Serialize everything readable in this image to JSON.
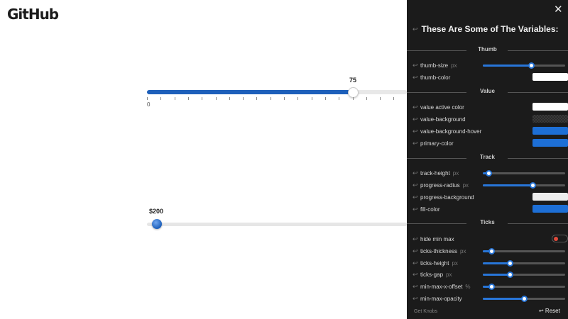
{
  "logo": "GitHub",
  "slider1": {
    "value": 75,
    "min_label": "0",
    "fill_fraction": 0.793,
    "tick_count": 20
  },
  "slider2": {
    "value_label": "$200",
    "fill_fraction": 0.02
  },
  "panel": {
    "close": "✕",
    "return_glyph": "↩",
    "title": "These Are Some of The Variables:",
    "sections": {
      "thumb": "Thumb",
      "value": "Value",
      "track": "Track",
      "ticks": "Ticks"
    },
    "rows": {
      "thumb_size": {
        "label": "thumb-size",
        "unit": "px",
        "fraction": 0.59
      },
      "thumb_color": {
        "label": "thumb-color",
        "color": "#ffffff"
      },
      "value_active_color": {
        "label": "value active color",
        "color": "#ffffff"
      },
      "value_background": {
        "label": "value-background",
        "color": "transparent"
      },
      "value_background_hover": {
        "label": "value-background-hover",
        "color": "#1d6fd6"
      },
      "primary_color": {
        "label": "primary-color",
        "color": "#1d6fd6"
      },
      "track_height": {
        "label": "track-height",
        "unit": "px",
        "fraction": 0.07
      },
      "progress_radius": {
        "label": "progress-radius",
        "unit": "px",
        "fraction": 0.6
      },
      "progress_background": {
        "label": "progress-background",
        "color": "#eeeeee"
      },
      "fill_color": {
        "label": "fill-color",
        "color": "#1d6fd6"
      },
      "hide_min_max": {
        "label": "hide min max",
        "checked": false
      },
      "ticks_thickness": {
        "label": "ticks-thickness",
        "unit": "px",
        "fraction": 0.1
      },
      "ticks_height": {
        "label": "ticks-height",
        "unit": "px",
        "fraction": 0.33
      },
      "ticks_gap": {
        "label": "ticks-gap",
        "unit": "px",
        "fraction": 0.33
      },
      "min_max_x_offset": {
        "label": "min-max-x-offset",
        "unit": "%",
        "fraction": 0.1
      },
      "min_max_opacity": {
        "label": "min-max-opacity",
        "fraction": 0.5
      }
    },
    "footer": "Get Knobs",
    "reset": "↩ Reset"
  },
  "colors": {
    "accent": "#1d5fba",
    "panel_bg": "#1b1b1b",
    "toggle_dot": "#e14a3b"
  }
}
